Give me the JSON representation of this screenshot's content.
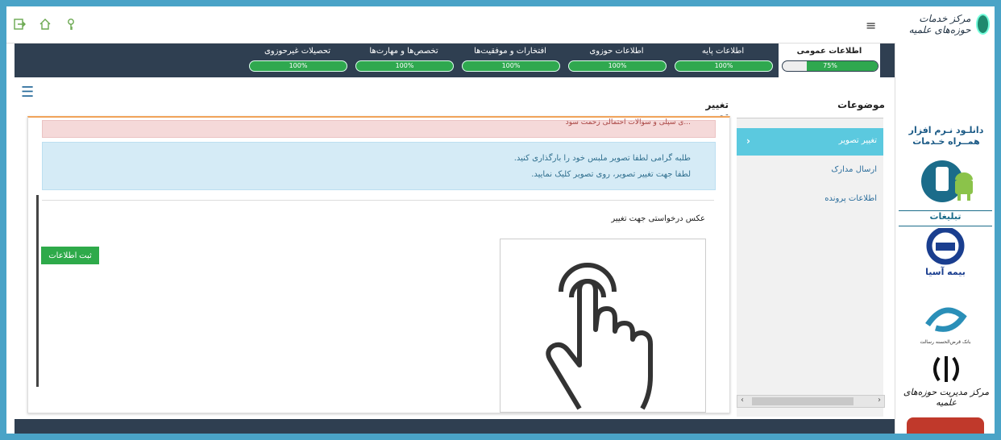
{
  "header": {
    "logo_text": "مرکز خدمات حوزه‌های علمیه",
    "top_icons": [
      "logout-icon",
      "home-icon",
      "key-icon"
    ],
    "menu_icon": "hamburger-icon"
  },
  "progress": {
    "items": [
      {
        "label": "تحصیلات غیرحوزوی",
        "value": "100%",
        "percent": 100
      },
      {
        "label": "تخصص‌ها و مهارت‌ها",
        "value": "100%",
        "percent": 100
      },
      {
        "label": "افتخارات و موفقیت‌ها",
        "value": "100%",
        "percent": 100
      },
      {
        "label": "اطلاعات حوزوی",
        "value": "100%",
        "percent": 100
      },
      {
        "label": "اطلاعات پایه",
        "value": "100%",
        "percent": 100
      }
    ],
    "general": {
      "label": "اطلاعات عمومی",
      "value": "75%",
      "percent": 75
    }
  },
  "topics": {
    "title": "موضوعات",
    "items": [
      {
        "label": "تغییر تصویر",
        "active": true
      },
      {
        "label": "ارسال مدارک",
        "active": false
      },
      {
        "label": "اطلاعات پرونده",
        "active": false
      }
    ]
  },
  "content": {
    "title": "تغییر تصویر",
    "alert_red": "...ی سپلی و سوالات احتمالی زحمت سود",
    "alert_blue_line1": "طلبه گرامی لطفا تصویر ملبس خود را بارگذاری کنید.",
    "alert_blue_line2": "لطفا جهت تغییر تصویر، روی تصویر کلیک نمایید.",
    "photo_label": "عکس درخواستی جهت تغییر",
    "save_label": "ثبت اطلاعات"
  },
  "sidebar": {
    "download_line1": "دانلـود نـرم افزار",
    "download_line2": "همــراه خـدمات",
    "ads_label": "تبلیغات",
    "ad_bime": "بیمه آسیا",
    "ad_bank": "بانک قرض‌الحسنه رسالت",
    "ad_markaz": "مرکز مدیریت حوزه‌های علمیه"
  },
  "colors": {
    "accent": "#5bc9df",
    "progress_green": "#2fa84f",
    "dark_strip": "#2f3f51",
    "frame": "#4aa3c7"
  }
}
